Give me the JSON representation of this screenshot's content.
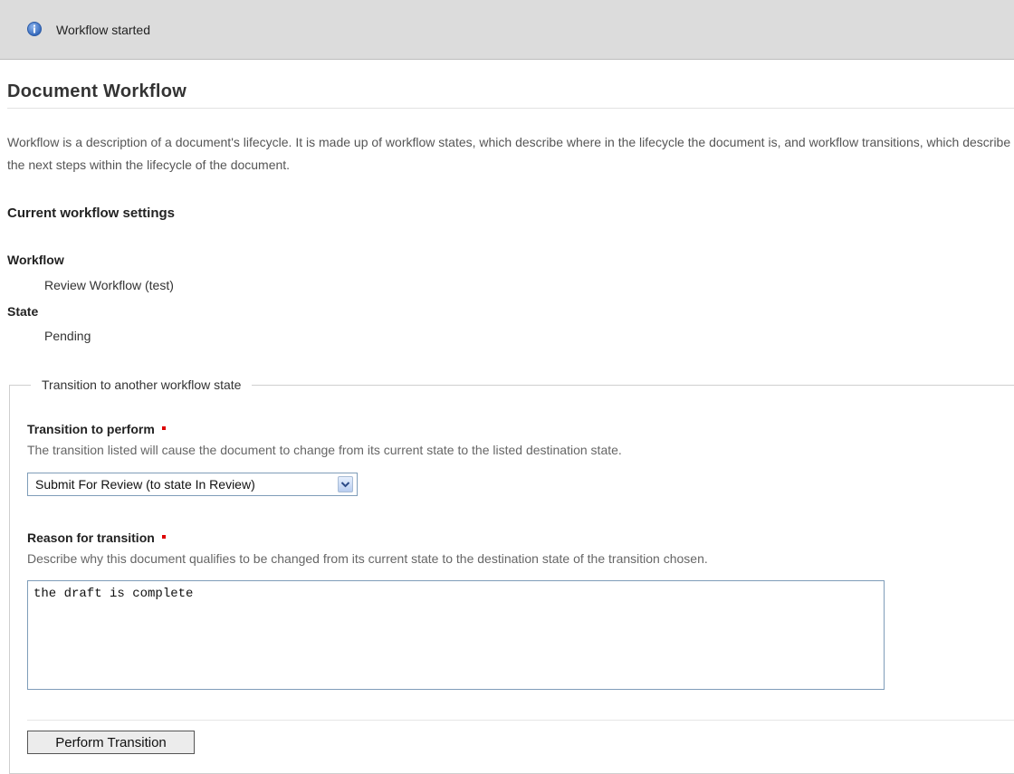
{
  "message": {
    "icon": "info-icon",
    "text": "Workflow started"
  },
  "page": {
    "title": "Document Workflow",
    "description": "Workflow is a description of a document's lifecycle. It is made up of workflow states, which describe where in the lifecycle the document is, and workflow transitions, which describe the next steps within the lifecycle of the document."
  },
  "current_settings": {
    "heading": "Current workflow settings",
    "workflow_label": "Workflow",
    "workflow_value": "Review Workflow (test)",
    "state_label": "State",
    "state_value": "Pending"
  },
  "transition_form": {
    "legend": "Transition to another workflow state",
    "transition_label": "Transition to perform",
    "transition_help": "The transition listed will cause the document to change from its current state to the listed destination state.",
    "transition_selected": "Submit For Review (to state In Review)",
    "reason_label": "Reason for transition",
    "reason_help": "Describe why this document qualifies to be changed from its current state to the destination state of the transition chosen.",
    "reason_value": "the draft is complete",
    "submit_label": "Perform Transition"
  },
  "colors": {
    "message_bg": "#dcdcdc",
    "required_marker": "#dd0000",
    "info_icon": "#3b73c8"
  }
}
